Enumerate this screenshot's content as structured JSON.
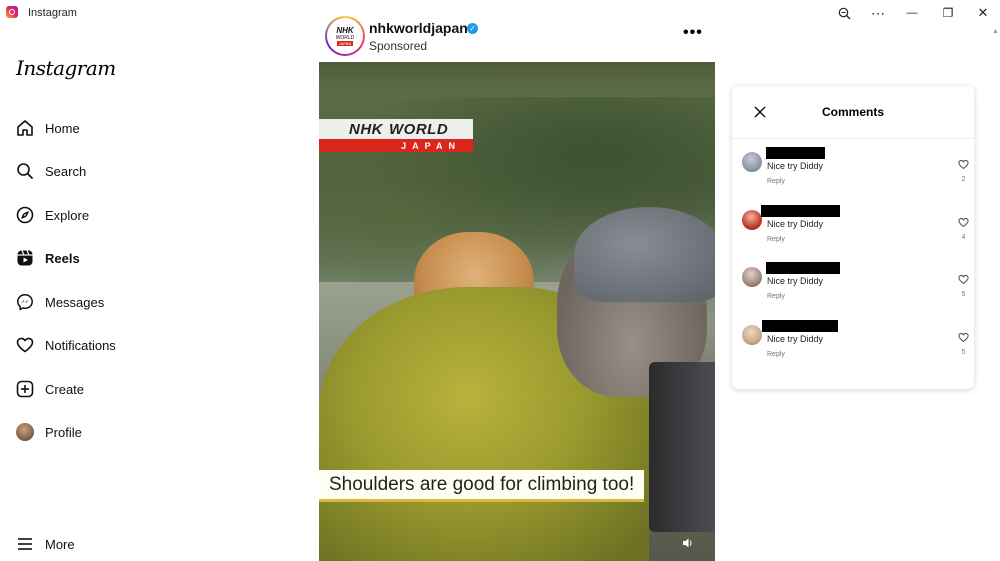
{
  "window": {
    "title": "Instagram",
    "controls": {
      "zoom": "zoom-icon",
      "more": "⋯",
      "minimize": "—",
      "restore": "❐",
      "close": "✕"
    }
  },
  "sidebar": {
    "logo": "Instagram",
    "items": [
      {
        "label": "Home",
        "icon": "home-icon"
      },
      {
        "label": "Search",
        "icon": "search-icon"
      },
      {
        "label": "Explore",
        "icon": "compass-icon"
      },
      {
        "label": "Reels",
        "icon": "reels-icon",
        "active": true
      },
      {
        "label": "Messages",
        "icon": "messenger-icon"
      },
      {
        "label": "Notifications",
        "icon": "heart-icon"
      },
      {
        "label": "Create",
        "icon": "plus-square-icon"
      },
      {
        "label": "Profile",
        "icon": "profile-avatar"
      }
    ],
    "more": "More"
  },
  "post": {
    "avatar": {
      "line1": "NHK",
      "line2": "WORLD",
      "line3": "JAPAN"
    },
    "username": "nhkworldjapan",
    "verified": true,
    "subtitle": "Sponsored",
    "options": "•••",
    "video": {
      "badge_brand": "NHK",
      "badge_word": "WORLD",
      "badge_country": "JAPAN",
      "caption": "Shoulders are good for climbing too!",
      "volume_icon": "speaker-icon"
    }
  },
  "comments": {
    "title": "Comments",
    "close_icon": "close-icon",
    "items": [
      {
        "text": "Nice try Diddy",
        "reply": "Reply",
        "likes": "2",
        "avatar_color": "#8e98a6"
      },
      {
        "text": "Nice try Diddy",
        "reply": "Reply",
        "likes": "4",
        "avatar_color": "#c0392b"
      },
      {
        "text": "Nice try Diddy",
        "reply": "Reply",
        "likes": "5",
        "avatar_color": "#a1887f"
      },
      {
        "text": "Nice try Diddy",
        "reply": "Reply",
        "likes": "5",
        "avatar_color": "#c9a88b"
      }
    ]
  }
}
